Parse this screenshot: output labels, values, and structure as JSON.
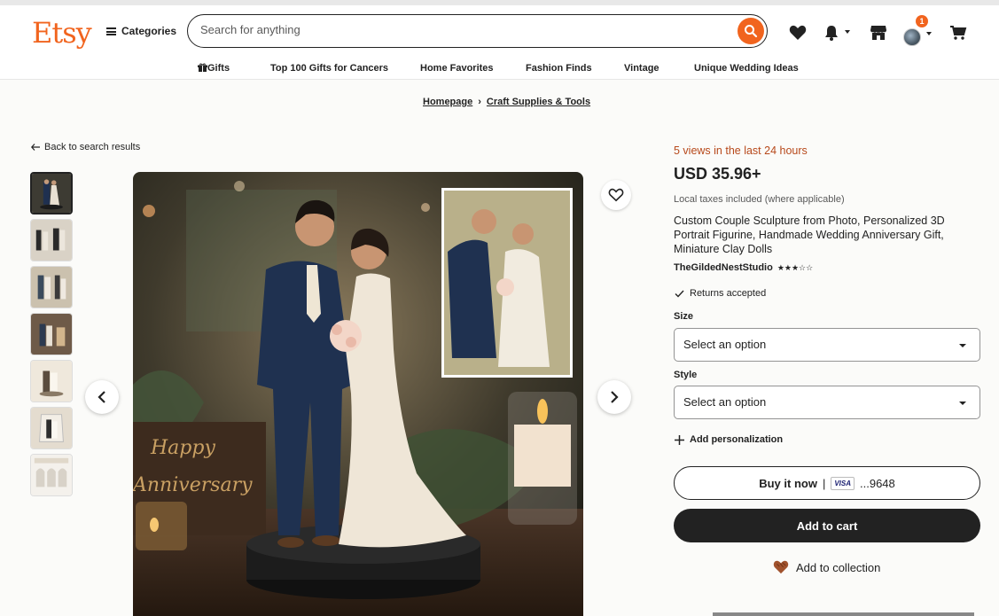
{
  "header": {
    "logo": "Etsy",
    "categories_label": "Categories",
    "search_placeholder": "Search for anything",
    "notification_count": "1"
  },
  "subnav": [
    "Gifts",
    "Top 100 Gifts for Cancers",
    "Home Favorites",
    "Fashion Finds",
    "Vintage",
    "Unique Wedding Ideas"
  ],
  "breadcrumb": {
    "home": "Homepage",
    "separator": "›",
    "category": "Craft Supplies & Tools"
  },
  "back_link": "Back to search results",
  "listing": {
    "views": "5 views in the last 24 hours",
    "price": "USD 35.96+",
    "taxes": "Local taxes included (where applicable)",
    "title": "Custom Couple Sculpture from Photo, Personalized 3D Portrait Figurine, Handmade Wedding Anniversary Gift, Miniature Clay Dolls",
    "shop_name": "TheGildedNestStudio",
    "rating": 2.5,
    "stars_display": "★★★☆☆",
    "returns": "Returns accepted",
    "size_label": "Size",
    "size_value": "Select an option",
    "style_label": "Style",
    "style_value": "Select an option",
    "add_personalization": "Add personalization",
    "buy_now": "Buy it now",
    "buy_now_separator": "|",
    "card_brand": "VISA",
    "card_last4": "...9648",
    "add_to_cart": "Add to cart",
    "add_to_collection": "Add to collection"
  },
  "image_texts": {
    "sign_line1": "Happy",
    "sign_line2": "Anniversary"
  },
  "colors": {
    "brand": "#f1641e",
    "views_text": "#b7491b",
    "dark_button": "#222222"
  }
}
